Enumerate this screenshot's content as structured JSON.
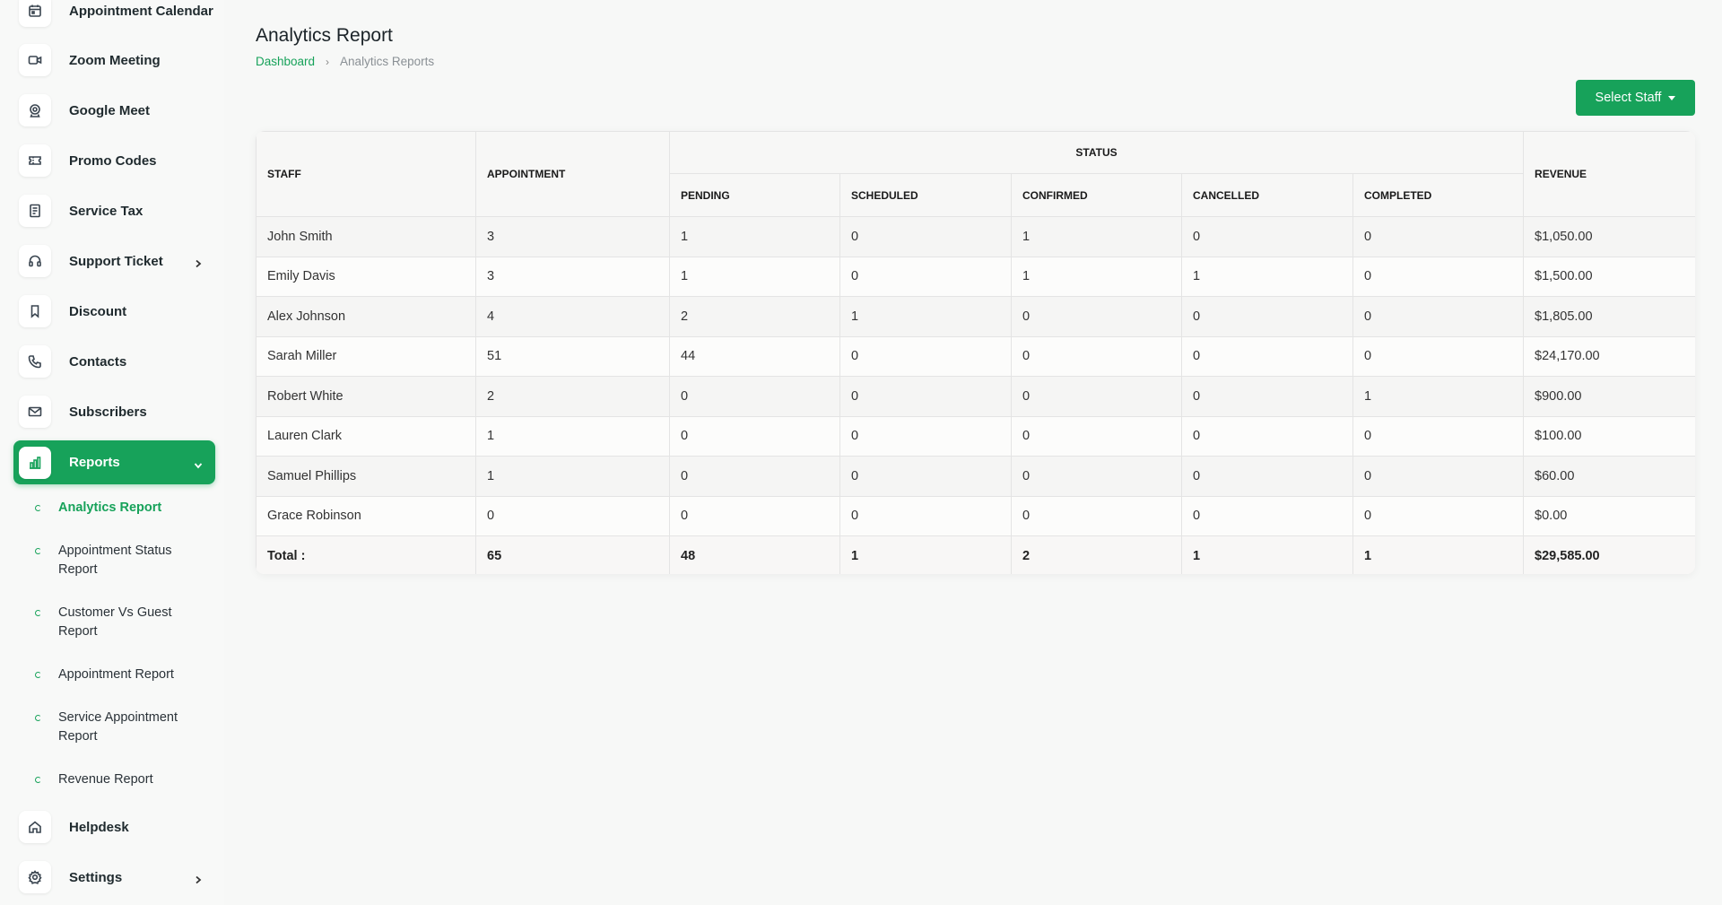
{
  "sidebar": {
    "items": [
      {
        "label": "Appointment Calendar",
        "icon": "calendar-icon"
      },
      {
        "label": "Zoom Meeting",
        "icon": "video-icon"
      },
      {
        "label": "Google Meet",
        "icon": "webcam-icon"
      },
      {
        "label": "Promo Codes",
        "icon": "ticket-icon"
      },
      {
        "label": "Service Tax",
        "icon": "receipt-icon"
      },
      {
        "label": "Support Ticket",
        "icon": "headset-icon"
      },
      {
        "label": "Discount",
        "icon": "bookmark-icon"
      },
      {
        "label": "Contacts",
        "icon": "phone-icon"
      },
      {
        "label": "Subscribers",
        "icon": "mail-icon"
      },
      {
        "label": "Reports",
        "icon": "bar-chart-icon"
      },
      {
        "label": "Helpdesk",
        "icon": "home-icon"
      },
      {
        "label": "Settings",
        "icon": "gear-icon"
      }
    ],
    "report_subitems": [
      {
        "label": "Analytics Report"
      },
      {
        "label": "Appointment Status Report"
      },
      {
        "label": "Customer Vs Guest Report"
      },
      {
        "label": "Appointment Report"
      },
      {
        "label": "Service Appointment Report"
      },
      {
        "label": "Revenue Report"
      }
    ]
  },
  "header": {
    "title": "Analytics Report",
    "breadcrumb_home": "Dashboard",
    "breadcrumb_separator": "›",
    "breadcrumb_current": "Analytics Reports"
  },
  "actions": {
    "select_staff_label": "Select Staff"
  },
  "colors": {
    "accent": "#17a25a"
  },
  "table": {
    "headers": {
      "staff": "STAFF",
      "appointment": "APPOINTMENT",
      "status": "STATUS",
      "pending": "PENDING",
      "scheduled": "SCHEDULED",
      "confirmed": "CONFIRMED",
      "cancelled": "CANCELLED",
      "completed": "COMPLETED",
      "revenue": "REVENUE"
    },
    "rows": [
      {
        "staff": "John Smith",
        "appointment": "3",
        "pending": "1",
        "scheduled": "0",
        "confirmed": "1",
        "cancelled": "0",
        "completed": "0",
        "revenue": "$1,050.00"
      },
      {
        "staff": "Emily Davis",
        "appointment": "3",
        "pending": "1",
        "scheduled": "0",
        "confirmed": "1",
        "cancelled": "1",
        "completed": "0",
        "revenue": "$1,500.00"
      },
      {
        "staff": "Alex Johnson",
        "appointment": "4",
        "pending": "2",
        "scheduled": "1",
        "confirmed": "0",
        "cancelled": "0",
        "completed": "0",
        "revenue": "$1,805.00"
      },
      {
        "staff": "Sarah Miller",
        "appointment": "51",
        "pending": "44",
        "scheduled": "0",
        "confirmed": "0",
        "cancelled": "0",
        "completed": "0",
        "revenue": "$24,170.00"
      },
      {
        "staff": "Robert White",
        "appointment": "2",
        "pending": "0",
        "scheduled": "0",
        "confirmed": "0",
        "cancelled": "0",
        "completed": "1",
        "revenue": "$900.00"
      },
      {
        "staff": "Lauren Clark",
        "appointment": "1",
        "pending": "0",
        "scheduled": "0",
        "confirmed": "0",
        "cancelled": "0",
        "completed": "0",
        "revenue": "$100.00"
      },
      {
        "staff": "Samuel Phillips",
        "appointment": "1",
        "pending": "0",
        "scheduled": "0",
        "confirmed": "0",
        "cancelled": "0",
        "completed": "0",
        "revenue": "$60.00"
      },
      {
        "staff": "Grace Robinson",
        "appointment": "0",
        "pending": "0",
        "scheduled": "0",
        "confirmed": "0",
        "cancelled": "0",
        "completed": "0",
        "revenue": "$0.00"
      }
    ],
    "total": {
      "label": "Total :",
      "appointment": "65",
      "pending": "48",
      "scheduled": "1",
      "confirmed": "2",
      "cancelled": "1",
      "completed": "1",
      "revenue": "$29,585.00"
    }
  }
}
